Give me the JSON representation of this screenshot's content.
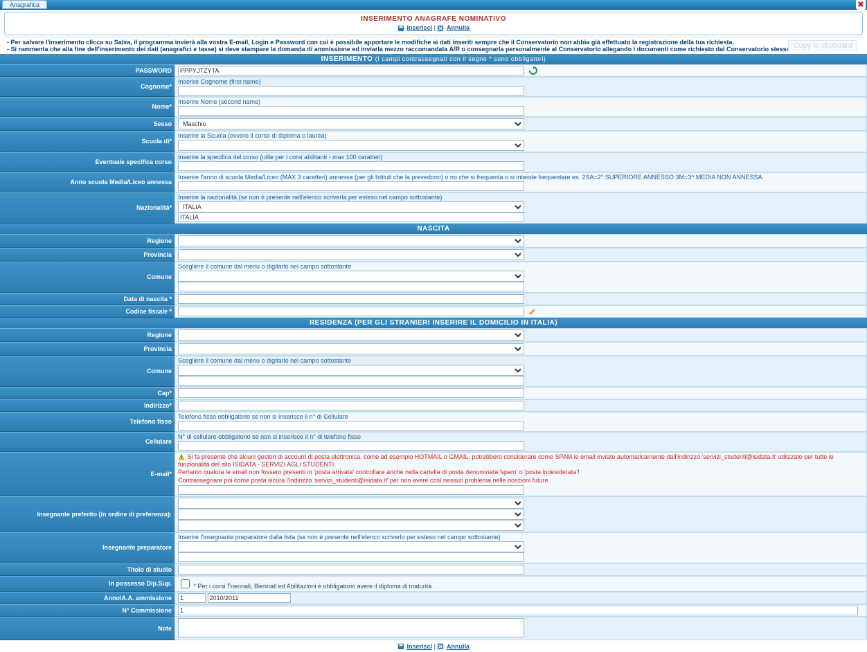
{
  "tab_label": "Anagrafica",
  "panel_title": "INSERIMENTO ANAGRAFE NOMINATIVO",
  "link_inserisci": "Inserisci",
  "link_annulla": "Annulla",
  "note1": "- Per salvare l'inserimento clicca su Salva, il programma invierà alla vostra E-mail, Login e Password con cui è possibile apportare le modifiche ai dati inseriti sempre che il Conservatorio non abbia già effettuato la registrazione della tua richiesta.",
  "note2": "- Si rammenta che alla fine dell'inserimento dei dati (anagrafici e tasse) si deve stampare la domanda di ammissione ed inviarla mezzo raccomandata A/R o consegnarla personalmente al Conservatorio allegando i documenti come richiesto dal Conservatorio stesso.",
  "copy_hint": "Copy to clipboard",
  "sections": {
    "inserimento": "INSERIMENTO",
    "inserimento_sub": "(I campi contrassegnati con il segno * sono obbligatori)",
    "nascita": "NASCITA",
    "residenza": "RESIDENZA (PER GLI STRANIERI INSERIRE IL DOMICILIO IN ITALIA)"
  },
  "labels": {
    "password": "PASSWORD",
    "cognome": "Cognome*",
    "nome": "Nome*",
    "sesso": "Sesso",
    "scuola": "Scuola di*",
    "specifica": "Eventuale specifica corso",
    "anno_scuola": "Anno scuola Media/Liceo annessa",
    "nazionalita": "Nazionalità*",
    "nascita_regione": "Regione",
    "nascita_provincia": "Provincia",
    "nascita_comune": "Comune",
    "data_nascita": "Data di nascita *",
    "codice_fiscale": "Codice fiscale *",
    "res_regione": "Regione",
    "res_provincia": "Provincia",
    "res_comune": "Comune",
    "cap": "Cap*",
    "indirizzo": "Indirizzo*",
    "telefono": "Telefono fisso",
    "cellulare": "Cellulare",
    "email": "E-mail*",
    "insegnante_preferito": "Insegnante preferito (in ordine di preferenza):",
    "insegnante_preparatore": "Insegnante preparatore",
    "titolo_studio": "Titolo di studio",
    "possesso_dip": "In possesso Dip.Sup.",
    "anno_aa": "Anno\\A.A. ammissione",
    "n_commissione": "N° Commissione",
    "note": "Note"
  },
  "hints": {
    "cognome": "Inserire Cognome (first name)",
    "nome": "Inserire Nome (second name)",
    "scuola": "Inserire la Scuola (ovvero il corso di diploma o laurea)",
    "specifica": "Inserire la specifica del corso (utile per i corsi abilitanti - max 100 caratteri)",
    "anno_scuola": "Inserire l'anno di scuola Media/Liceo (MAX 3 caratteri) annessa (per gli Istituti che la prevedono) o no che si frequenta o si intende frequentare es. 2SA=2° SUPERIORE ANNESSO 3M=3^ MEDIA NON ANNESSA",
    "nazionalita": "Inserire la nazionalità (se non è presente nell'elenco scriverla per esteso nel campo sottostante)",
    "comune": "Scegliere il comune dal menu o digitarlo nel campo sottostante",
    "telefono": "Telefono fisso obbligatorio se non si inserisce il n° di Cellulare",
    "cellulare": "N° di cellulare obbligatorio se non si inserisce il n° di telefono fisso",
    "email1": "Si fa presente che alcuni gestori di account di posta elettronica, come ad esempio HOTMAIL o GMAIL, potrebbero considerare come SPAM le email inviate automaticamente dall'indirizzo 'servizi_studenti@isidata.it' utilizzato per tutte le funzionalità del sito ISIDATA - SERVIZI AGLI STUDENTI.",
    "email2": "Pertanto qualora le email non fossero presenti in 'posta arrivata' controllare anche nella cartella di posta denominata 'spam' o 'posta indesiderata'!",
    "email3": "Contrassegnare poi come posta sicura l'indirizzo 'servizi_studenti@isidata.it' per non avere così nessun problema nelle ricezioni future.",
    "preparatore": "Inserire l'insegnante preparatore dalla lista (se non è presente nell'elenco scriverlo per esteso nel campo sottostante)",
    "dip_sup": "* Per i corsi Triennali, Biennali ed Abilitazioni è obbligatorio avere il diploma di maturità"
  },
  "values": {
    "password": "PPPYJTZYTA",
    "sesso": "Maschio",
    "nazionalita_sel": "ITALIA",
    "nazionalita_txt": "ITALIA",
    "anno_amm_n": "1",
    "anno_amm_aa": "2010/2011",
    "n_commissione": "1"
  }
}
